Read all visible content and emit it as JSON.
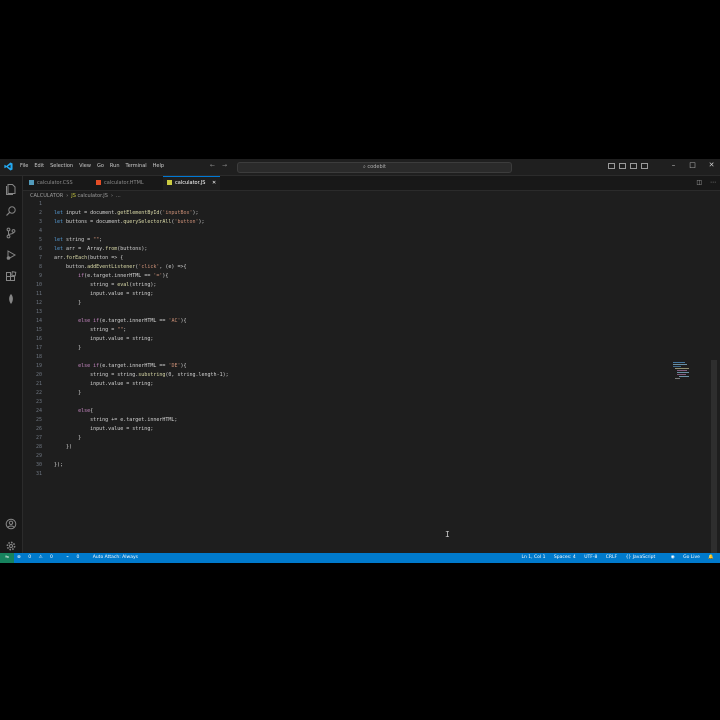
{
  "menu": [
    "File",
    "Edit",
    "Selection",
    "View",
    "Go",
    "Run",
    "Terminal",
    "Help"
  ],
  "search": {
    "text": "codebit"
  },
  "tabs": [
    {
      "label": "calculator.CSS",
      "icon_color": "#519aba"
    },
    {
      "label": "calculator.HTML",
      "icon_color": "#e44d26"
    },
    {
      "label": "calculator.JS",
      "icon_color": "#cbcb41",
      "active": true
    }
  ],
  "breadcrumb": {
    "folder": "CALCULATOR",
    "file": "calculator.JS",
    "rest": "..."
  },
  "code_lines": [
    "",
    "let input = document.getElementById('inputBox');",
    "let buttons = document.querySelectorAll('button');",
    "",
    "let string = \"\";",
    "let arr =  Array.from(buttons);",
    "arr.forEach(button => {",
    "    button.addEventListener('click', (e) =>{",
    "        if(e.target.innerHTML == '='){",
    "            string = eval(string);",
    "            input.value = string;",
    "        }",
    "",
    "        else if(e.target.innerHTML == 'AC'){",
    "            string = \"\";",
    "            input.value = string;",
    "        }",
    "",
    "        else if(e.target.innerHTML == 'DE'){",
    "            string = string.substring(0, string.length-1);",
    "            input.value = string;",
    "        }",
    "",
    "        else{",
    "            string += e.target.innerHTML;",
    "            input.value = string;",
    "        }",
    "    })",
    "",
    "});",
    ""
  ],
  "status": {
    "problems_errors": "0",
    "problems_warnings": "0",
    "ports": "0",
    "auto_attach": "Auto Attach: Always",
    "position": "Ln 1, Col 1",
    "spaces": "Spaces: 4",
    "encoding": "UTF-8",
    "eol": "CRLF",
    "language": "{} JavaScript",
    "golive": "Go Live"
  },
  "colors": {
    "accent": "#007acc",
    "remote": "#16825d",
    "editor_bg": "#1e1e1e"
  },
  "icons": [
    "vscode-logo-icon",
    "explorer-icon",
    "search-icon",
    "source-control-icon",
    "run-debug-icon",
    "extensions-icon",
    "remote-explorer-icon",
    "accounts-icon",
    "manage-gear-icon"
  ]
}
